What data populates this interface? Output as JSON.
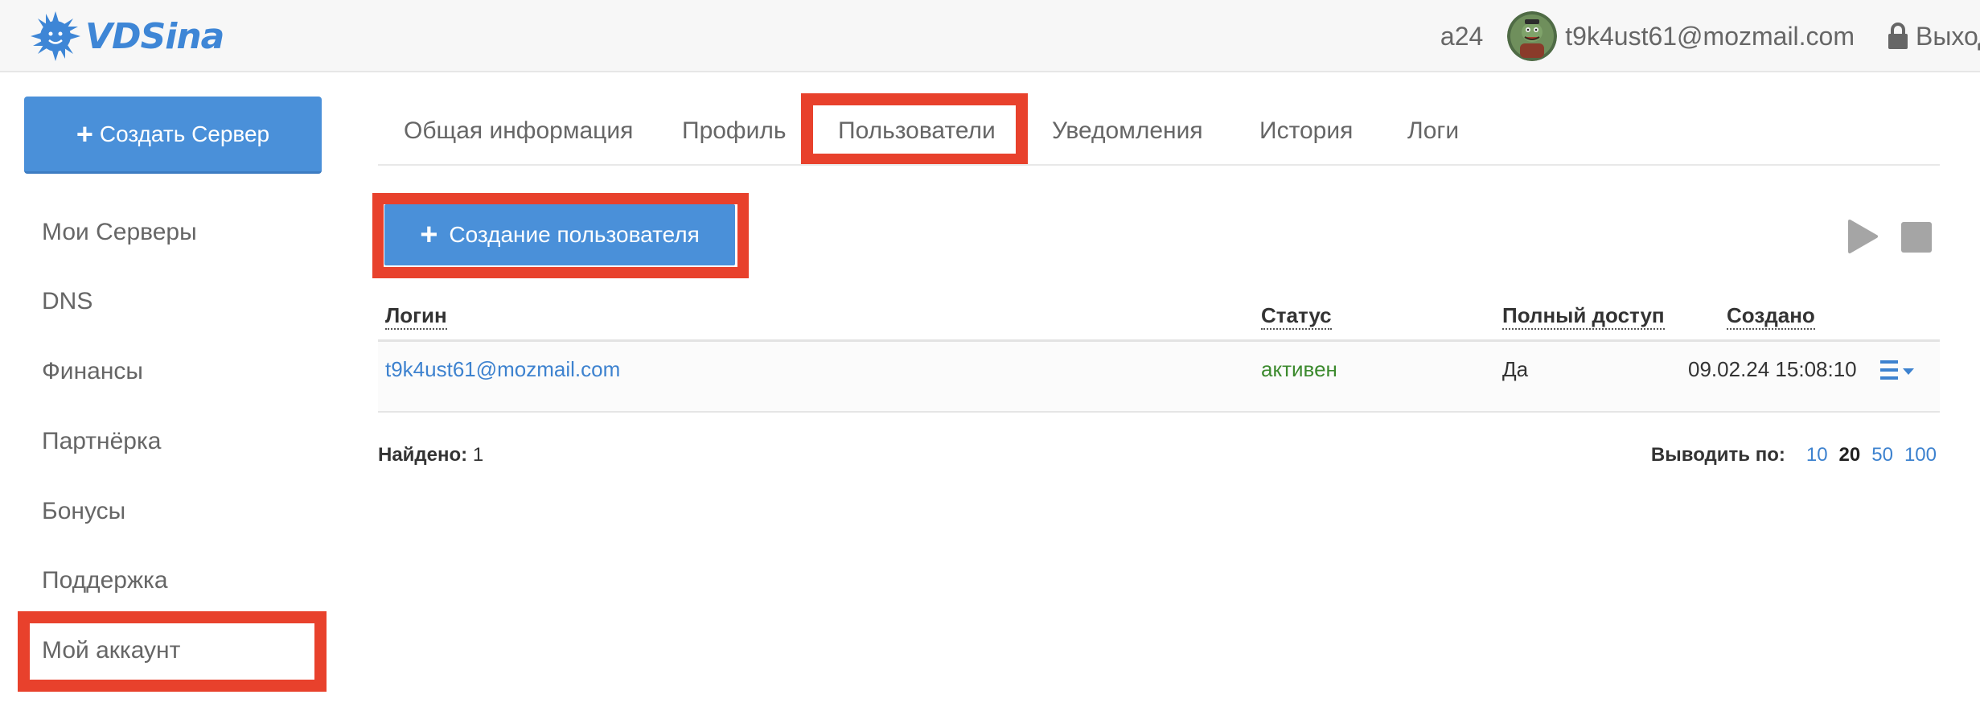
{
  "header": {
    "logo_text": "VDSina",
    "account_id": "a24",
    "user_email": "t9k4ust61@mozmail.com",
    "logout_label": "Выход"
  },
  "sidebar": {
    "create_server_label": "Создать Сервер",
    "items": [
      {
        "label": "Мои Серверы"
      },
      {
        "label": "DNS"
      },
      {
        "label": "Финансы"
      },
      {
        "label": "Партнёрка"
      },
      {
        "label": "Бонусы"
      },
      {
        "label": "Поддержка"
      },
      {
        "label": "Мой аккаунт",
        "active": true
      }
    ]
  },
  "tabs": [
    {
      "label": "Общая информация"
    },
    {
      "label": "Профиль"
    },
    {
      "label": "Пользователи",
      "active": true
    },
    {
      "label": "Уведомления"
    },
    {
      "label": "История"
    },
    {
      "label": "Логи"
    }
  ],
  "toolbar": {
    "create_user_label": "Создание пользователя",
    "play_icon": "play-icon",
    "stop_icon": "stop-icon"
  },
  "table": {
    "columns": [
      "Логин",
      "Статус",
      "Полный доступ",
      "Создано"
    ],
    "rows": [
      {
        "login": "t9k4ust61@mozmail.com",
        "status": "активен",
        "full_access": "Да",
        "created": "09.02.24 15:08:10"
      }
    ]
  },
  "footer": {
    "found_label": "Найдено:",
    "found_count": "1",
    "perpage_label": "Выводить по:",
    "perpage_options": [
      "10",
      "20",
      "50",
      "100"
    ],
    "perpage_selected": "20"
  },
  "colors": {
    "accent": "#4a90d9",
    "highlight": "#e8412c",
    "status_active": "#3c8a2e",
    "link": "#3d82cf"
  }
}
